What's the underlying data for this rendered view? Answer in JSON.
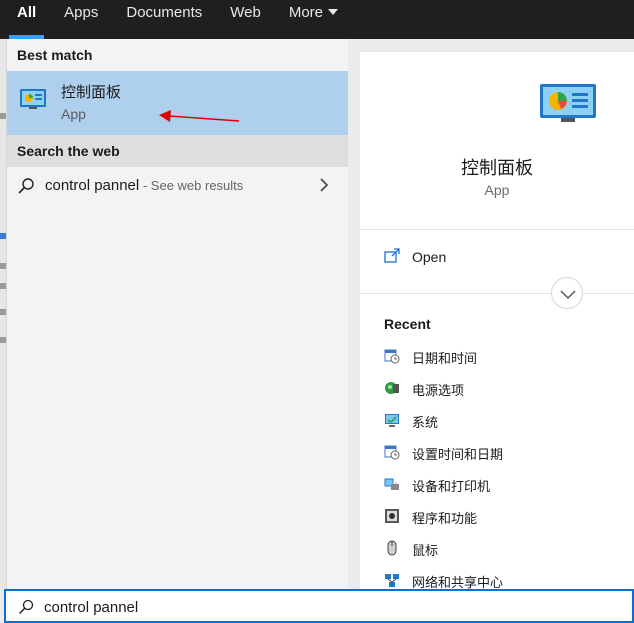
{
  "nav": {
    "tabs": [
      {
        "label": "All",
        "active": true
      },
      {
        "label": "Apps"
      },
      {
        "label": "Documents"
      },
      {
        "label": "Web"
      },
      {
        "label": "More"
      }
    ]
  },
  "results": {
    "best_match_heading": "Best match",
    "best_match": {
      "name": "控制面板",
      "type": "App",
      "icon": "control-panel-icon"
    },
    "web_heading": "Search the web",
    "web_result": {
      "query": "control pannel",
      "hint": " - See web results"
    }
  },
  "preview": {
    "name": "控制面板",
    "type": "App",
    "open_label": "Open",
    "recent_heading": "Recent",
    "recent": [
      {
        "label": "日期和时间",
        "icon": "datetime-icon"
      },
      {
        "label": "电源选项",
        "icon": "power-options-icon"
      },
      {
        "label": "系统",
        "icon": "system-icon"
      },
      {
        "label": "设置时间和日期",
        "icon": "set-datetime-icon"
      },
      {
        "label": "设备和打印机",
        "icon": "devices-printers-icon"
      },
      {
        "label": "程序和功能",
        "icon": "programs-features-icon"
      },
      {
        "label": "鼠标",
        "icon": "mouse-icon"
      },
      {
        "label": "网络和共享中心",
        "icon": "network-sharing-icon"
      }
    ]
  },
  "search": {
    "value": "control pannel"
  },
  "colors": {
    "accent": "#0a6fd6",
    "selected": "#aecfee",
    "nav_bg": "#1f1f1f",
    "arrow": "#e00000"
  }
}
